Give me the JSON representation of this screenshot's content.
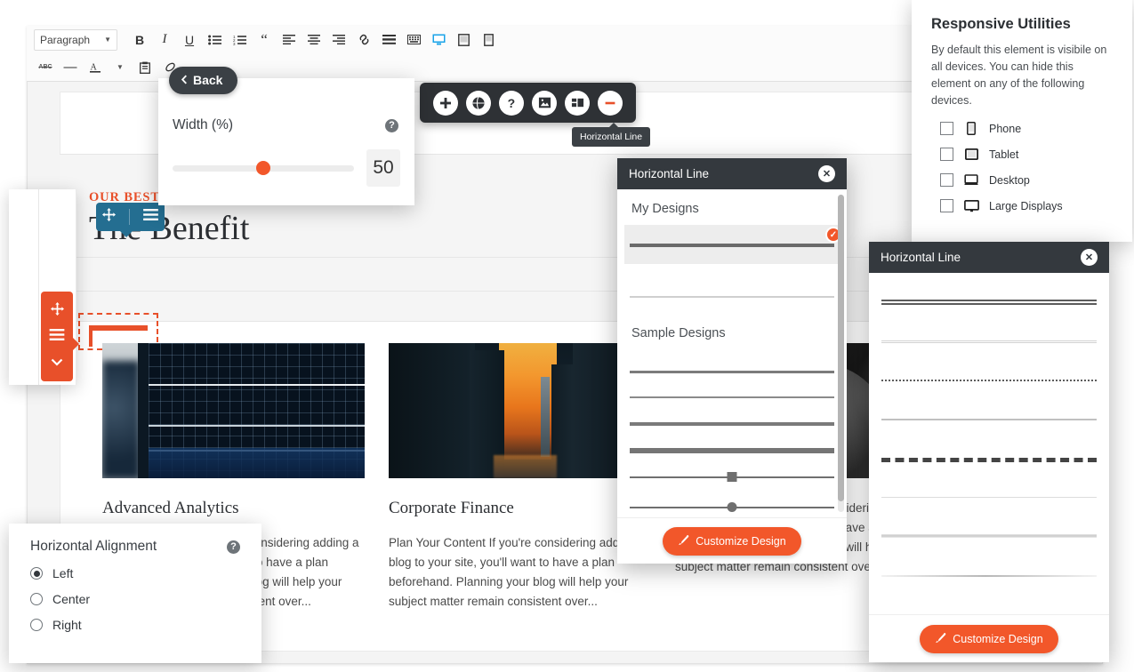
{
  "editor": {
    "toolbar": {
      "paragraph_select": "Paragraph",
      "row1": [
        {
          "name": "bold-icon",
          "glyph": "B"
        },
        {
          "name": "italic-icon",
          "glyph": "I"
        },
        {
          "name": "underline-icon",
          "glyph": "U"
        },
        {
          "name": "bulleted-list-icon",
          "glyph": "≡"
        },
        {
          "name": "numbered-list-icon",
          "glyph": "≡"
        },
        {
          "name": "blockquote-icon",
          "glyph": "“"
        },
        {
          "name": "align-left-icon",
          "glyph": "≡"
        },
        {
          "name": "align-center-icon",
          "glyph": "≡"
        },
        {
          "name": "align-right-icon",
          "glyph": "≡"
        },
        {
          "name": "link-icon",
          "glyph": "🔗"
        },
        {
          "name": "insert-more-icon",
          "glyph": "▤"
        },
        {
          "name": "keyboard-shortcuts-icon",
          "glyph": "⌨"
        },
        {
          "name": "desktop-preview-icon",
          "glyph": "🖥"
        },
        {
          "name": "tablet-preview-icon",
          "glyph": "▭"
        },
        {
          "name": "mobile-preview-icon",
          "glyph": "▯"
        }
      ],
      "row2": [
        {
          "name": "strikethrough-icon",
          "glyph": "ABC"
        },
        {
          "name": "horizontal-rule-icon",
          "glyph": "—"
        },
        {
          "name": "text-color-icon",
          "glyph": "A"
        },
        {
          "name": "text-color-dropdown-icon",
          "glyph": "▾"
        },
        {
          "name": "paste-as-text-icon",
          "glyph": "🗐"
        },
        {
          "name": "clear-formatting-icon",
          "glyph": "⊘"
        }
      ]
    },
    "content": {
      "eyebrow": "OUR BEST BUSINESS",
      "heading": "The Benefit",
      "cards": [
        {
          "title": "Advanced Analytics",
          "body": "Plan Your Content If you're considering adding a blog to your site, you'll want to have a plan beforehand. Planning your blog will help your subject matter remain consistent over...",
          "image": "stock-chart-image"
        },
        {
          "title": "Corporate Finance",
          "body": "Plan Your Content If you're considering adding a blog to your site, you'll want to have a plan beforehand. Planning your blog will help your subject matter remain consistent over...",
          "image": "city-sunset-image"
        },
        {
          "title": "",
          "body": "Plan Your Content If you're considering adding a blog to your site, you'll want to have a plan beforehand. Planning your blog will help your subject matter remain consistent over...",
          "image": "black-white-portrait-image"
        }
      ]
    }
  },
  "width_panel": {
    "back_label": "Back",
    "back_icon": "chevron-left-icon",
    "field_label": "Width (%)",
    "help_icon": "question-mark-icon",
    "value": "50",
    "slider_percent": 50
  },
  "module_toolbar": {
    "buttons": [
      {
        "name": "add-module-icon",
        "glyph": "+"
      },
      {
        "name": "global-module-icon",
        "glyph": "●"
      },
      {
        "name": "help-icon",
        "glyph": "?"
      },
      {
        "name": "image-module-icon",
        "glyph": "▣"
      },
      {
        "name": "layout-module-icon",
        "glyph": "▦"
      },
      {
        "name": "remove-module-icon",
        "glyph": "–"
      }
    ],
    "tooltip": "Horizontal Line"
  },
  "responsive_panel": {
    "title": "Responsive Utilities",
    "description": "By default this element is visibile on all devices. You can hide this element on any of the following devices.",
    "options": [
      {
        "label": "Phone",
        "icon": "phone-icon",
        "checked": false
      },
      {
        "label": "Tablet",
        "icon": "tablet-icon",
        "checked": false
      },
      {
        "label": "Desktop",
        "icon": "desktop-icon",
        "checked": false
      },
      {
        "label": "Large Displays",
        "icon": "large-display-icon",
        "checked": false
      }
    ]
  },
  "modal_designs": {
    "title": "Horizontal Line",
    "close_icon": "close-icon",
    "my_designs_label": "My Designs",
    "sample_designs_label": "Sample Designs",
    "selected_badge_icon": "check-circle-icon",
    "customize_button": "Customize Design",
    "customize_icon": "brush-icon"
  },
  "modal_samples": {
    "title": "Horizontal Line",
    "close_icon": "close-icon",
    "customize_button": "Customize Design",
    "customize_icon": "brush-icon"
  },
  "align_panel": {
    "title": "Horizontal Alignment",
    "help_icon": "question-mark-icon",
    "options": [
      {
        "label": "Left",
        "selected": true
      },
      {
        "label": "Center",
        "selected": false
      },
      {
        "label": "Right",
        "selected": false
      }
    ]
  },
  "handles": {
    "blue": [
      {
        "name": "move-icon",
        "glyph": "✥"
      },
      {
        "name": "menu-icon",
        "glyph": "☰"
      }
    ],
    "orange": [
      {
        "name": "move-icon",
        "glyph": "✥"
      },
      {
        "name": "menu-icon",
        "glyph": "☰"
      },
      {
        "name": "chevron-down-icon",
        "glyph": "⌄"
      }
    ]
  },
  "colors": {
    "accent_orange": "#e8502a",
    "button_orange": "#f2572a",
    "dark_panel": "#34393e",
    "blue_handle": "#246e91",
    "toolbar_active_blue": "#1aa3e8"
  }
}
